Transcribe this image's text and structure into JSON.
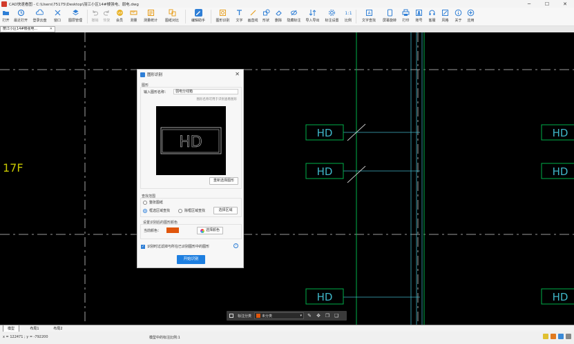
{
  "window": {
    "title": "CAD快速看图 - C:\\Users\\75175\\Desktop\\丽江小区14#楼强电、弱电.dwg",
    "minimize": "─",
    "maximize": "☐",
    "close": "✕"
  },
  "toolbar": {
    "items": [
      {
        "label": "打开",
        "icon": "folder-open-icon"
      },
      {
        "label": "最近打开",
        "icon": "history-icon"
      },
      {
        "label": "登录云盘",
        "icon": "cloud-icon"
      },
      {
        "label": "窗口",
        "icon": "fullscreen-icon"
      },
      {
        "label": "图层管理",
        "icon": "layers-icon"
      },
      {
        "label": "撤销",
        "icon": "undo-icon",
        "disabled": true
      },
      {
        "label": "恢复",
        "icon": "redo-icon",
        "disabled": true
      },
      {
        "label": "会员",
        "icon": "vip-icon"
      },
      {
        "label": "测量",
        "icon": "measure-icon"
      },
      {
        "label": "测量统计",
        "icon": "measure-stats-icon"
      },
      {
        "label": "图纸对比",
        "icon": "compare-icon"
      },
      {
        "label": "编辑助手",
        "icon": "edit-assistant-icon",
        "active": true
      },
      {
        "label": "图形识别",
        "icon": "shape-recognize-icon"
      },
      {
        "label": "文字",
        "icon": "text-icon"
      },
      {
        "label": "画直线",
        "icon": "line-icon"
      },
      {
        "label": "形状",
        "icon": "shape-icon"
      },
      {
        "label": "删除",
        "icon": "eraser-icon"
      },
      {
        "label": "隐藏标注",
        "icon": "hide-annotation-icon"
      },
      {
        "label": "导入导出",
        "icon": "import-export-icon"
      },
      {
        "label": "标注设置",
        "icon": "annotation-settings-icon"
      },
      {
        "label": "比例",
        "icon": "scale-icon"
      },
      {
        "label": "文字查找",
        "icon": "text-search-icon"
      },
      {
        "label": "屏幕旋转",
        "icon": "rotate-screen-icon"
      },
      {
        "label": "打印",
        "icon": "print-icon"
      },
      {
        "label": "账号",
        "icon": "account-icon"
      },
      {
        "label": "客服",
        "icon": "headset-icon"
      },
      {
        "label": "风格",
        "icon": "style-icon"
      },
      {
        "label": "关于",
        "icon": "info-icon"
      },
      {
        "label": "应用",
        "icon": "apps-icon"
      }
    ]
  },
  "doc_tab": {
    "label": "丽江小区14#楼强电...",
    "close": "✕"
  },
  "canvas": {
    "floor_label": "17F",
    "block_text": "HD",
    "colors": {
      "line": "#00b04a",
      "cyan": "#3fb6c8",
      "text": "#c8c800",
      "dash": "#cfcfcf"
    }
  },
  "dialog": {
    "title": "图形识别",
    "close": "✕",
    "section_shape": "图形",
    "name_label": "输入图形名称：",
    "name_value": "弱电分线箱",
    "name_hint": "图形名称可用于识别查看图形",
    "preview_text": "HD",
    "reselect_button": "重新选择图形",
    "section_range": "查找范围",
    "range_options": [
      {
        "label": "整张图纸",
        "selected": false
      },
      {
        "label": "框选区域查找",
        "selected": true
      },
      {
        "label": "除框区域查找",
        "selected": false
      }
    ],
    "select_area_button": "选择区域",
    "section_color": "设置识别后的图形颜色",
    "current_color_label": "当前颜色：",
    "current_color": "#e0560c",
    "choose_color_button": "选择颜色",
    "rotate_checkbox_label": "识别时过滤掉与所在已识别图形中的图形",
    "rotate_checked": true,
    "help": "?",
    "start_button": "开始识别"
  },
  "annotation_bar": {
    "label": "标注分类",
    "category": "未分类",
    "dropdown_arrow": "▾"
  },
  "layout_tabs": [
    {
      "label": "模型",
      "active": true
    },
    {
      "label": "布局1",
      "active": false
    },
    {
      "label": "布局2",
      "active": false
    }
  ],
  "status": {
    "coords": "x = 122471 ; y = -792200",
    "scale": "模型中的标注比例:1"
  }
}
